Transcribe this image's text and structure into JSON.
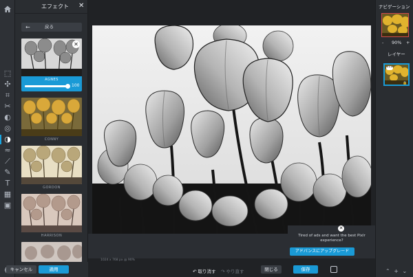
{
  "effects_panel": {
    "title": "エフェクト",
    "back_label": "戻る",
    "active_effect": {
      "name": "AGNES",
      "value": "100",
      "level_percent": 100
    },
    "effects": [
      "CONNY",
      "GORDON",
      "HARRISON"
    ],
    "cancel_label": "キャンセル",
    "apply_label": "適用"
  },
  "toolbar": {
    "icons": [
      "home-icon",
      "crop-icon",
      "move-icon",
      "crop-tool-icon",
      "scissors-icon",
      "adjust-icon",
      "filter-icon",
      "effect-icon",
      "wave-icon",
      "brush-icon",
      "pencil-icon",
      "text-icon",
      "pattern-icon",
      "image-icon",
      "settings-icon"
    ]
  },
  "canvas": {
    "status_text": "1024 x 768 px @ 90%"
  },
  "ad": {
    "message": "Tired of ads and want the best Pixlr experience?",
    "button_label": "アドバンスにアップグレード"
  },
  "bottom_bar": {
    "undo_label": "取り消す",
    "redo_label": "やり直す",
    "close_label": "閉じる",
    "save_label": "保存"
  },
  "navigation_panel": {
    "title": "ナビゲーション",
    "zoom_minus": "-",
    "zoom_value": "90%",
    "zoom_plus": "+",
    "layers_title": "レイヤー"
  },
  "colors": {
    "accent": "#1a9ad6",
    "panel": "#2a2d31",
    "workspace": "#202225"
  }
}
